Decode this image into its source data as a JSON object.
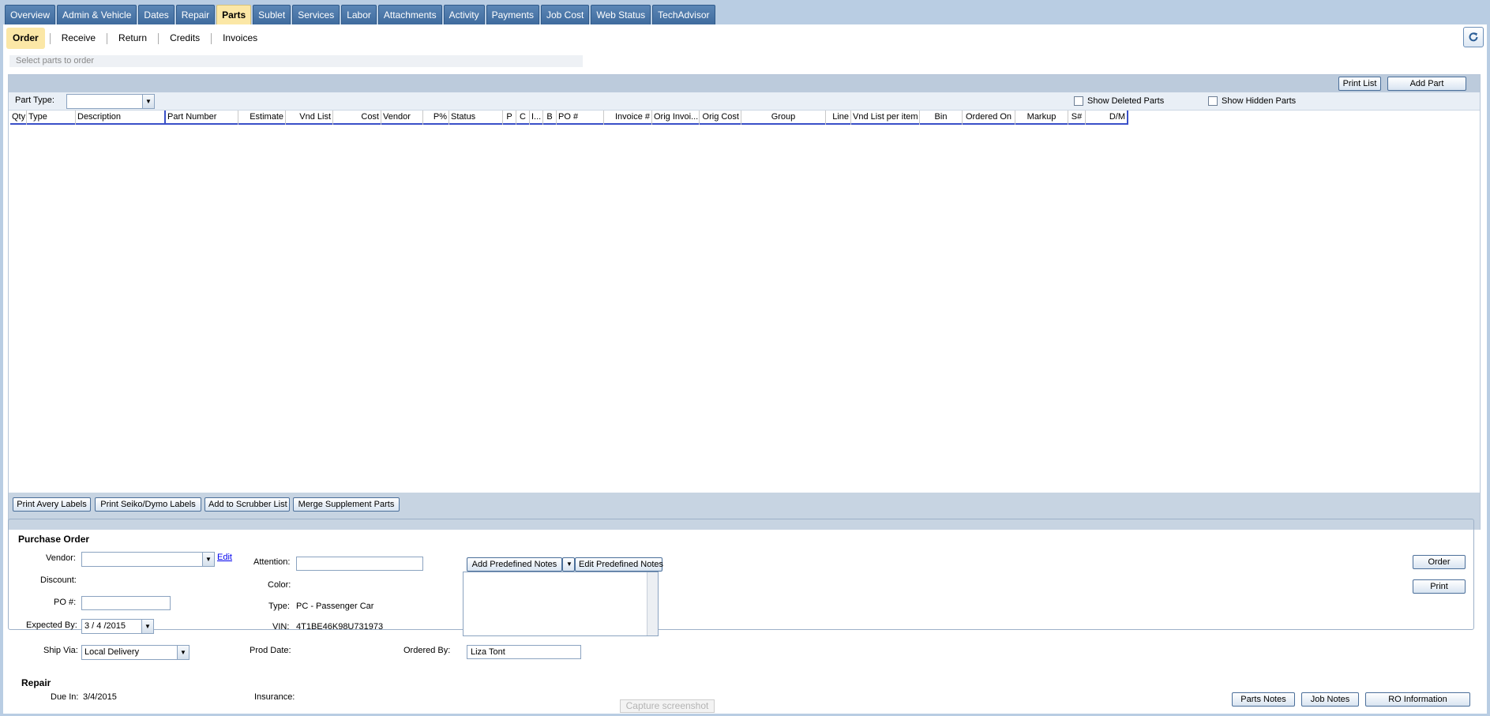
{
  "tabs": [
    "Overview",
    "Admin & Vehicle",
    "Dates",
    "Repair",
    "Parts",
    "Sublet",
    "Services",
    "Labor",
    "Attachments",
    "Activity",
    "Payments",
    "Job Cost",
    "Web Status",
    "TechAdvisor"
  ],
  "active_tab": "Parts",
  "subtabs": [
    "Order",
    "Receive",
    "Return",
    "Credits",
    "Invoices"
  ],
  "hint": "Select parts to order",
  "toolbar": {
    "print_list": "Print List",
    "add_part": "Add Part"
  },
  "filters": {
    "part_type_label": "Part Type:",
    "show_deleted": "Show Deleted Parts",
    "show_hidden": "Show Hidden Parts"
  },
  "columns": [
    "Qty",
    "Type",
    "Description",
    "Part Number",
    "Estimate",
    "Vnd List",
    "Cost",
    "Vendor",
    "P%",
    "Status",
    "P",
    "C",
    "I...",
    "B",
    "PO #",
    "Invoice #",
    "Orig Invoi...",
    "Orig Cost",
    "Group",
    "Line",
    "Vnd List per item",
    "Bin",
    "Ordered On",
    "Markup",
    "S#",
    "D/M"
  ],
  "footer_buttons": [
    "Print Avery Labels",
    "Print Seiko/Dymo Labels",
    "Add to Scrubber List",
    "Merge Supplement Parts"
  ],
  "po": {
    "title": "Purchase Order",
    "vendor_label": "Vendor:",
    "edit_link": "Edit",
    "discount_label": "Discount:",
    "po_label": "PO #:",
    "expected_label": "Expected By:",
    "expected_value": "3 / 4 /2015",
    "shipvia_label": "Ship Via:",
    "shipvia_value": "Local Delivery",
    "attention_label": "Attention:",
    "color_label": "Color:",
    "type_label": "Type:",
    "type_value": "PC - Passenger Car",
    "vin_label": "VIN:",
    "vin_value": "4T1BE46K98U731973",
    "prod_date_label": "Prod Date:",
    "ordered_by_label": "Ordered By:",
    "ordered_by_value": "Liza Tont",
    "add_notes": "Add Predefined Notes",
    "edit_notes": "Edit Predefined Notes",
    "order_btn": "Order",
    "print_btn": "Print"
  },
  "repair": {
    "title": "Repair",
    "due_label": "Due In:",
    "due_value": "3/4/2015",
    "insurance_label": "Insurance:"
  },
  "bottom_buttons": {
    "parts_notes": "Parts Notes",
    "job_notes": "Job Notes",
    "ro_info": "RO Information"
  },
  "capture": "Capture screenshot"
}
